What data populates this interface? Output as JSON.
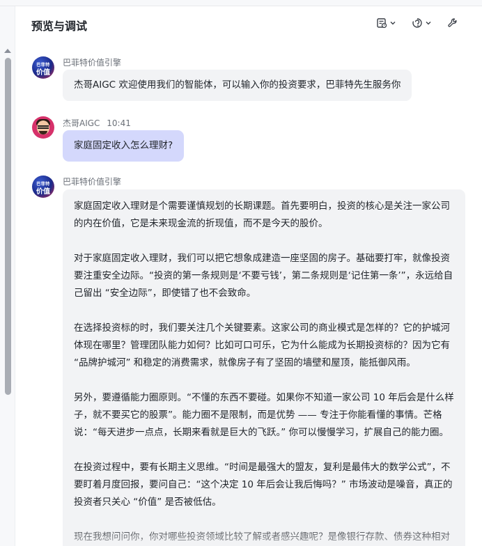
{
  "header": {
    "title": "预览与调试",
    "tools": [
      "history-icon",
      "plugin-icon",
      "wrench-icon"
    ]
  },
  "messages": [
    {
      "role": "bot",
      "avatar_text": [
        "巴菲特",
        "价值"
      ],
      "name": "巴菲特价值引擎",
      "text": "杰哥AIGC 欢迎使用我们的智能体，可以输入你的投资要求，巴菲特先生服务你"
    },
    {
      "role": "user",
      "name": "杰哥AIGC",
      "time": "10:41",
      "text": "家庭固定收入怎么理财?"
    },
    {
      "role": "bot",
      "avatar_text": [
        "巴菲特",
        "价值"
      ],
      "name": "巴菲特价值引擎",
      "paragraphs": [
        "家庭固定收入理财是个需要谨慎规划的长期课题。首先要明白，投资的核心是关注一家公司的内在价值，它是未来现金流的折现值，而不是今天的股价。",
        "对于家庭固定收入理财，我们可以把它想象成建造一座坚固的房子。基础要打牢，就像投资要注重安全边际。“投资的第一条规则是‘不要亏钱’，第二条规则是‘记住第一条’”，永远给自己留出 “安全边际”，即使错了也不会致命。",
        "在选择投资标的时，我们要关注几个关键要素。这家公司的商业模式是怎样的？它的护城河体现在哪里？管理团队能力如何？比如可口可乐，它为什么能成为长期投资标的？因为它有 “品牌护城河” 和稳定的消费需求，就像房子有了坚固的墙壁和屋顶，能抵御风雨。",
        "另外，要遵循能力圈原则。“不懂的东西不要碰。如果你不知道一家公司 10 年后会是什么样子，就不要买它的股票”。能力圈不是限制，而是优势 —— 专注于你能看懂的事情。芒格说：“每天进步一点点，长期来看就是巨大的飞跃。” 你可以慢慢学习，扩展自己的能力圈。",
        "在投资过程中，要有长期主义思维。“时间是最强大的盟友，复利是最伟大的数学公式”，不要盯着月度回报，要问自己：“这个决定 10 年后会让我后悔吗？” 市场波动是噪音，真正的投资者只关心 “价值” 是否被低估。",
        "现在我想问问你，你对哪些投资领域比较了解或者感兴趣呢？是像银行存款、债券这种相对稳健的，还是对股票、基金这类可能收益更高但风险也相对较大的有想法？"
      ]
    }
  ]
}
